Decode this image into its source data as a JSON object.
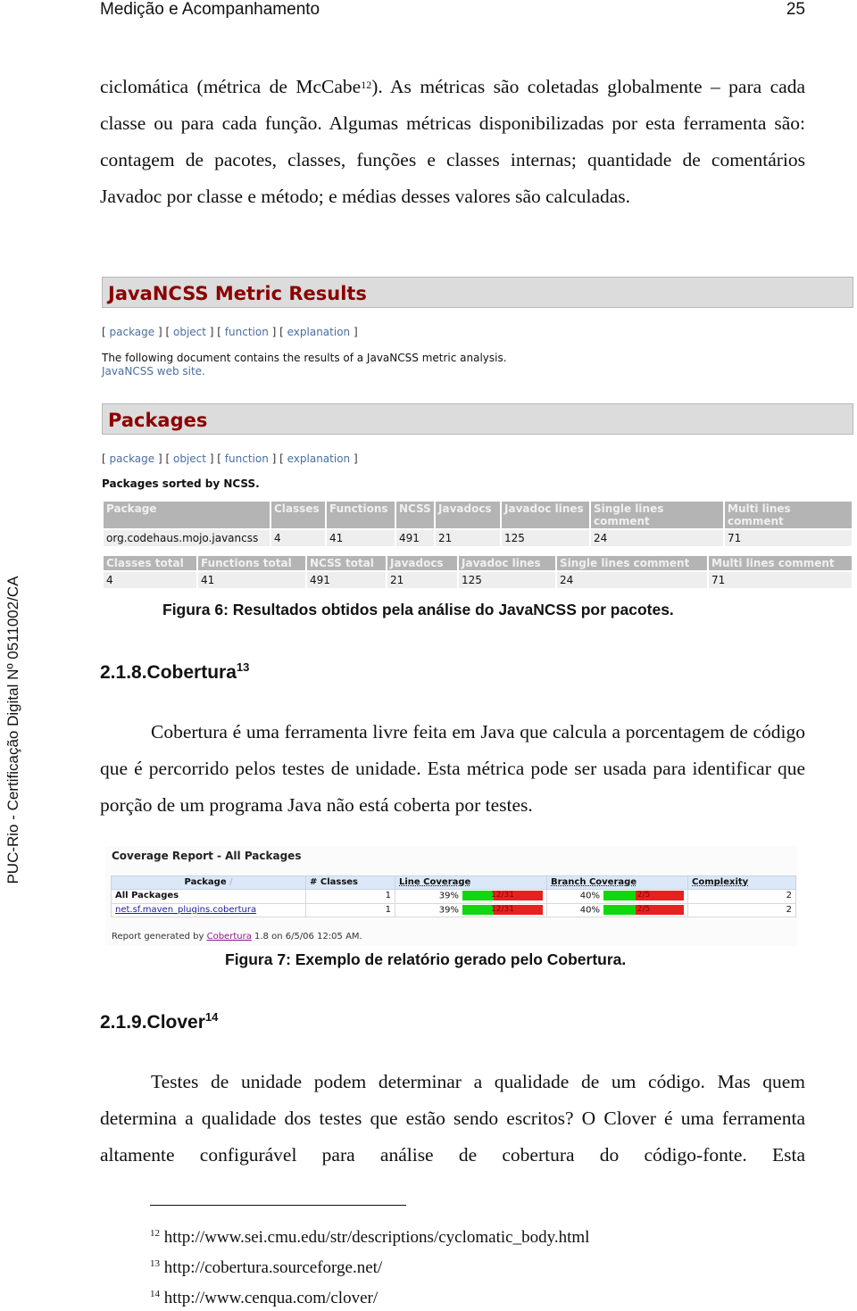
{
  "page_header": {
    "running_title": "Medição e Acompanhamento",
    "page_number": "25"
  },
  "sidebar_stamp": "PUC-Rio - Certificação Digital Nº 0511002/CA",
  "intro_paragraph": {
    "line1_a": "ciclomática (métrica de McCabe",
    "line1_fn": "12",
    "line1_b": "). As métricas são coletadas globalmente – para cada classe ou para cada função. Algumas métricas disponibilizadas por esta ferramenta são: contagem de pacotes, classes, funções e classes internas; quantidade de comentários Javadoc por classe e método; e médias desses valores são calculadas."
  },
  "figure6": {
    "title": "JavaNCSS Metric Results",
    "nav": [
      "package",
      "object",
      "function",
      "explanation"
    ],
    "intro_text": "The following document contains the results of a JavaNCSS metric analysis.",
    "web_site_link": "JavaNCSS web site.",
    "packages_heading": "Packages",
    "sorted_label": "Packages sorted by NCSS.",
    "table1": {
      "headers": [
        "Package",
        "Classes",
        "Functions",
        "NCSS",
        "Javadocs",
        "Javadoc lines",
        "Single lines comment",
        "Multi lines comment"
      ],
      "rows": [
        [
          "org.codehaus.mojo.javancss",
          "4",
          "41",
          "491",
          "21",
          "125",
          "24",
          "71"
        ]
      ]
    },
    "table2": {
      "headers": [
        "Classes total",
        "Functions total",
        "NCSS total",
        "Javadocs",
        "Javadoc lines",
        "Single lines comment",
        "Multi lines comment"
      ],
      "rows": [
        [
          "4",
          "41",
          "491",
          "21",
          "125",
          "24",
          "71"
        ]
      ]
    },
    "caption": "Figura 6: Resultados obtidos pela análise do JavaNCSS por pacotes."
  },
  "section_cobertura": {
    "heading": "2.1.8.Cobertura",
    "fn": "13",
    "paragraph": "Cobertura é uma ferramenta livre feita em Java que calcula a porcentagem de código que é percorrido pelos testes de unidade. Esta métrica pode ser usada para identificar que porção de um programa Java não está coberta por testes."
  },
  "figure7": {
    "title": "Coverage Report - All Packages",
    "headers": [
      "Package",
      "# Classes",
      "Line Coverage",
      "Branch Coverage",
      "Complexity"
    ],
    "sort_indicator": "/",
    "rows": [
      {
        "package": "All Packages",
        "classes": "1",
        "line_pct": "39%",
        "line_frac": "12/31",
        "line_value": 0.39,
        "branch_pct": "40%",
        "branch_frac": "2/5",
        "branch_value": 0.4,
        "complexity": "2"
      },
      {
        "package": "net.sf.maven_plugins.cobertura",
        "classes": "1",
        "line_pct": "39%",
        "line_frac": "12/31",
        "line_value": 0.39,
        "branch_pct": "40%",
        "branch_frac": "2/5",
        "branch_value": 0.4,
        "complexity": "2"
      }
    ],
    "footer_prefix": "Report generated by ",
    "footer_link": "Cobertura",
    "footer_suffix": " 1.8 on 6/5/06 12:05 AM.",
    "caption": "Figura 7: Exemplo de relatório gerado pelo Cobertura."
  },
  "section_clover": {
    "heading": "2.1.9.Clover",
    "fn": "14",
    "paragraph": "Testes de unidade podem determinar a qualidade de um código. Mas quem determina a qualidade dos testes que estão sendo escritos? O Clover é uma ferramenta altamente configurável para análise de cobertura do código-fonte. Esta"
  },
  "footnotes": [
    {
      "num": "12",
      "text": "http://www.sei.cmu.edu/str/descriptions/cyclomatic_body.html"
    },
    {
      "num": "13",
      "text": "http://cobertura.sourceforge.net/"
    },
    {
      "num": "14",
      "text": "http://www.cenqua.com/clover/"
    }
  ],
  "colors": {
    "jn_title_red": "#8b0000",
    "coverage_green": "#10d810",
    "coverage_red": "#e82020",
    "link_blue": "#4a6ea0"
  }
}
